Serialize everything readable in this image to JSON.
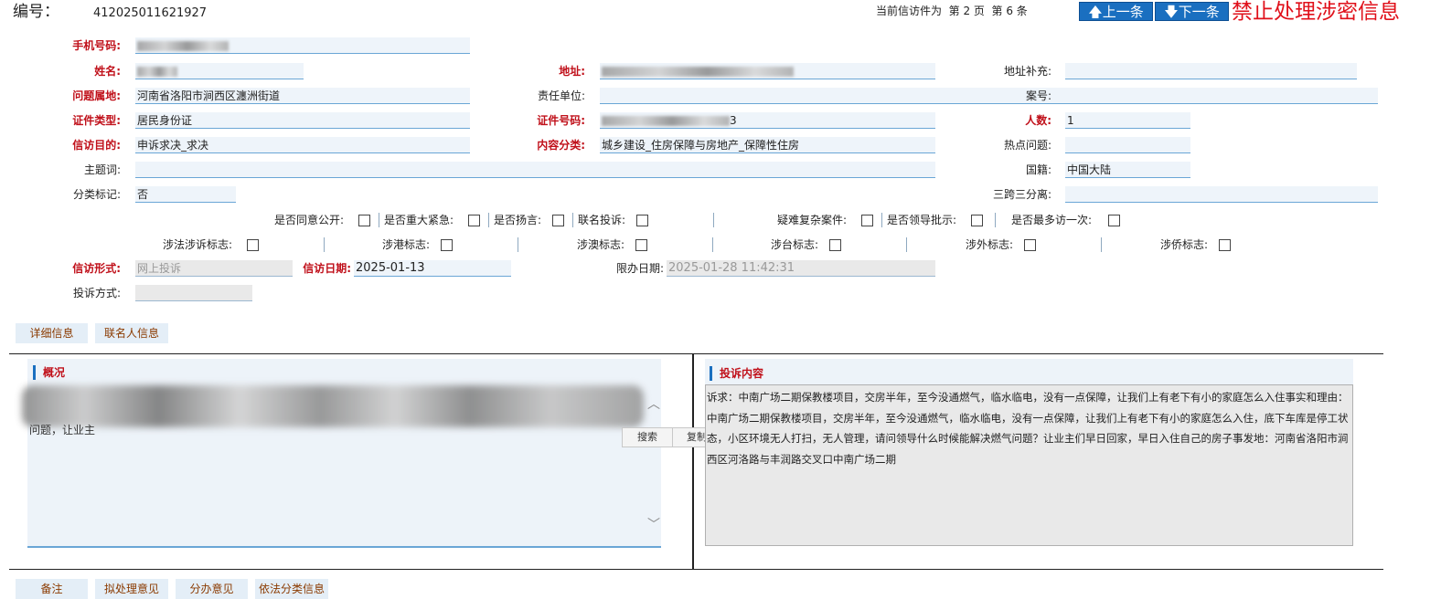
{
  "header": {
    "id_label": "编号：",
    "id_value": "412025011621927",
    "page_info": "当前信访件为  第 2 页  第 6 条",
    "prev_label": "上一条",
    "next_label": "下一条",
    "warning": "禁止处理涉密信息"
  },
  "form": {
    "phone_label": "手机号码:",
    "name_label": "姓名:",
    "address_label": "地址:",
    "address_extra_label": "地址补充:",
    "location_label": "问题属地:",
    "location_value": "河南省洛阳市涧西区瀍洲街道",
    "resp_unit_label": "责任单位:",
    "case_no_label": "案号:",
    "id_type_label": "证件类型:",
    "id_type_value": "居民身份证",
    "id_no_label": "证件号码:",
    "id_no_tail": "3",
    "people_label": "人数:",
    "people_value": "1",
    "purpose_label": "信访目的:",
    "purpose_value": "申诉求决_求决",
    "content_cat_label": "内容分类:",
    "content_cat_value": "城乡建设_住房保障与房地产_保障性住房",
    "hot_label": "热点问题:",
    "topic_label": "主题词:",
    "nationality_label": "国籍:",
    "nationality_value": "中国大陆",
    "class_mark_label": "分类标记:",
    "class_mark_value": "否",
    "three_label": "三跨三分离:",
    "form_type_label": "信访形式:",
    "form_type_value": "网上投诉",
    "date_label": "信访日期:",
    "date_value": "2025-01-13",
    "deadline_label": "限办日期:",
    "deadline_value": "2025-01-28 11:42:31",
    "complaint_method_label": "投诉方式:"
  },
  "checks_row1": [
    {
      "label": "是否同意公开:"
    },
    {
      "label": "是否重大紧急:"
    },
    {
      "label": "是否扬言:"
    },
    {
      "label": "联名投诉:"
    },
    {
      "label": "疑难复杂案件:"
    },
    {
      "label": "是否领导批示:"
    },
    {
      "label": "是否最多访一次:"
    }
  ],
  "checks_row2": [
    {
      "label": "涉法涉诉标志:"
    },
    {
      "label": "涉港标志:"
    },
    {
      "label": "涉澳标志:"
    },
    {
      "label": "涉台标志:"
    },
    {
      "label": "涉外标志:"
    },
    {
      "label": "涉侨标志:"
    }
  ],
  "tabs1": [
    "详细信息",
    "联名人信息"
  ],
  "summary": {
    "title": "概况",
    "visible_text": "问题，让业主"
  },
  "context_menu": {
    "search": "搜索",
    "copy": "复制"
  },
  "complaint": {
    "title": "投诉内容",
    "text": "诉求：中南广场二期保教楼项目，交房半年，至今没通燃气，临水临电，没有一点保障，让我们上有老下有小的家庭怎么入住事实和理由：中南广场二期保教楼项目，交房半年，至今没通燃气，临水临电，没有一点保障，让我们上有老下有小的家庭怎么入住，底下车库是停工状态，小区环境无人打扫，无人管理，请问领导什么时候能解决燃气问题？让业主们早日回家，早日入住自己的房子事发地：河南省洛阳市涧西区河洛路与丰润路交叉口中南广场二期"
  },
  "tabs2": [
    "备注",
    "拟处理意见",
    "分办意见",
    "依法分类信息"
  ],
  "colors": {
    "accent": "#1a6fc0",
    "required_label": "#c0101a",
    "field_bg": "#eef4fa"
  }
}
